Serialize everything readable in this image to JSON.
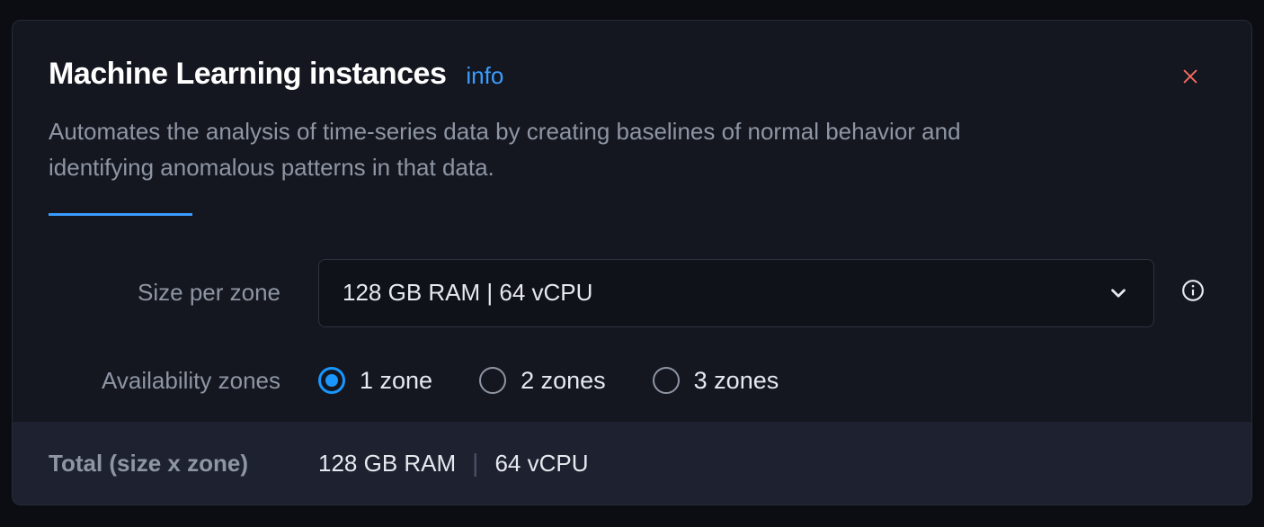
{
  "header": {
    "title": "Machine Learning instances",
    "info_link": "info",
    "description": "Automates the analysis of time-series data by creating baselines of normal behavior and identifying anomalous patterns in that data."
  },
  "form": {
    "size_label": "Size per zone",
    "size_value": "128 GB RAM | 64 vCPU",
    "zones_label": "Availability zones",
    "zones": [
      {
        "label": "1 zone",
        "checked": true
      },
      {
        "label": "2 zones",
        "checked": false
      },
      {
        "label": "3 zones",
        "checked": false
      }
    ]
  },
  "footer": {
    "label": "Total (size x zone)",
    "ram": "128 GB RAM",
    "cpu": "64 vCPU"
  }
}
